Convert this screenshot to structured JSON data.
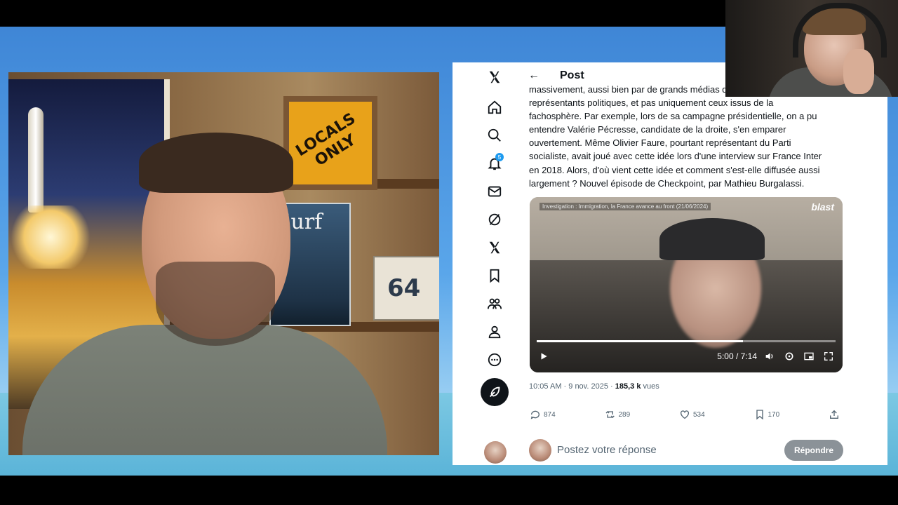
{
  "stream_cam": {
    "sign_text": "LOCALS\nONLY",
    "poster_text": "Surf",
    "plate_text": "64"
  },
  "twitter": {
    "header": {
      "back_icon": "arrow-left-icon",
      "title": "Post"
    },
    "nav_icons": [
      "x-logo-icon",
      "home-icon",
      "search-icon",
      "bell-icon",
      "mail-icon",
      "grok-icon",
      "x-premium-icon",
      "bookmark-icon",
      "communities-icon",
      "profile-icon",
      "more-icon"
    ],
    "notification_count": "5",
    "post_text": [
      "massivement, aussi bien par de grands médias que des",
      "représentants politiques, et pas uniquement ceux issus de la",
      "fachosphère. Par exemple, lors de sa campagne présidentielle, on a pu",
      "entendre Valérie Pécresse, candidate de la droite, s'en emparer",
      "ouvertement. Même Olivier Faure, pourtant représentant du Parti",
      "socialiste, avait joué avec cette idée lors d'une interview sur France Inter",
      "en 2018. Alors, d'où vient cette idée et comment s'est-elle diffusée aussi",
      "largement ? Nouvel épisode de Checkpoint, par Mathieu Burgalassi."
    ],
    "video": {
      "caption": "Investigation : Immigration, la France avance au front (21/06/2024)",
      "logo": "blast",
      "time": "5:00 / 7:14",
      "progress": 0.6912
    },
    "meta": {
      "time": "10:05 AM",
      "date": "9 nov. 2025",
      "views": "185,3 k",
      "views_label": "vues"
    },
    "actions": {
      "replies": "874",
      "reposts": "289",
      "likes": "534",
      "bookmarks": "170"
    },
    "reply": {
      "placeholder": "Postez votre réponse",
      "button": "Répondre"
    }
  }
}
